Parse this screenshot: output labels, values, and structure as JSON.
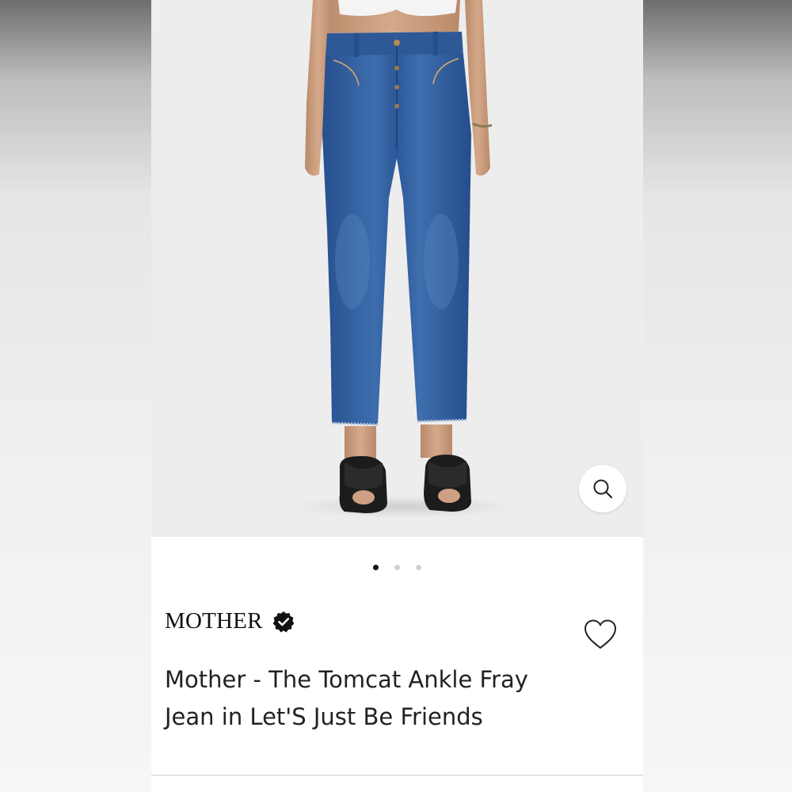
{
  "product": {
    "brand": "MOTHER",
    "brand_verified": true,
    "title": "Mother - The Tomcat Ankle Fray Jean in Let'S Just Be Friends"
  },
  "gallery": {
    "image_count": 3,
    "active_index": 0
  },
  "icons": {
    "zoom": "magnifier-icon",
    "verified": "verified-badge-icon",
    "favorite": "heart-outline-icon"
  },
  "colors": {
    "denim": "#2f5a9c",
    "background": "#ededed",
    "text": "#222222"
  }
}
